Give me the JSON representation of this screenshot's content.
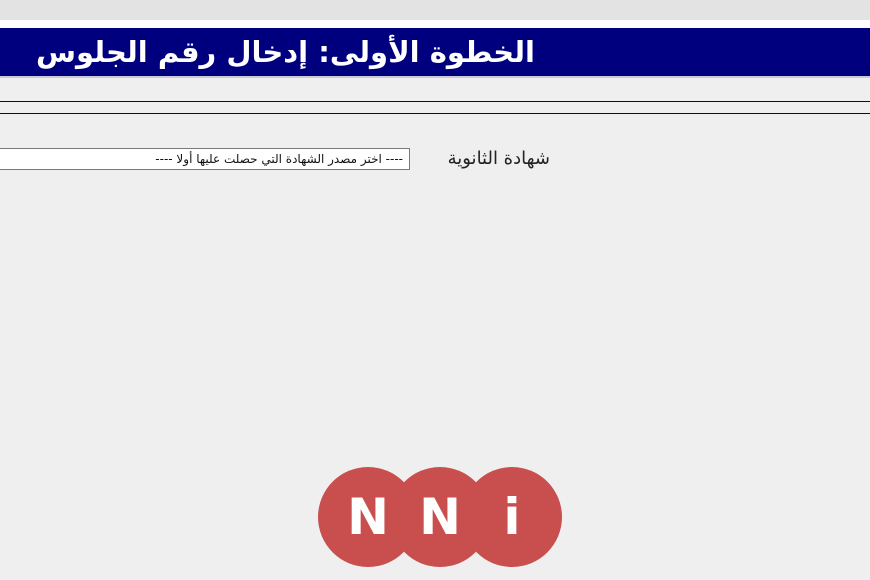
{
  "header": {
    "title": "الخطوة الأولى: إدخال رقم الجلوس"
  },
  "form": {
    "certificate_label": "شهادة الثانوية",
    "certificate_select_value": "---- اختر مصدر الشهادة التي حصلت عليها أولا ----"
  },
  "logo": {
    "letters": [
      "N",
      "N",
      "i"
    ],
    "color": "#c94f4f"
  },
  "colors": {
    "title_bar": "#00007f",
    "background": "#efefef"
  }
}
